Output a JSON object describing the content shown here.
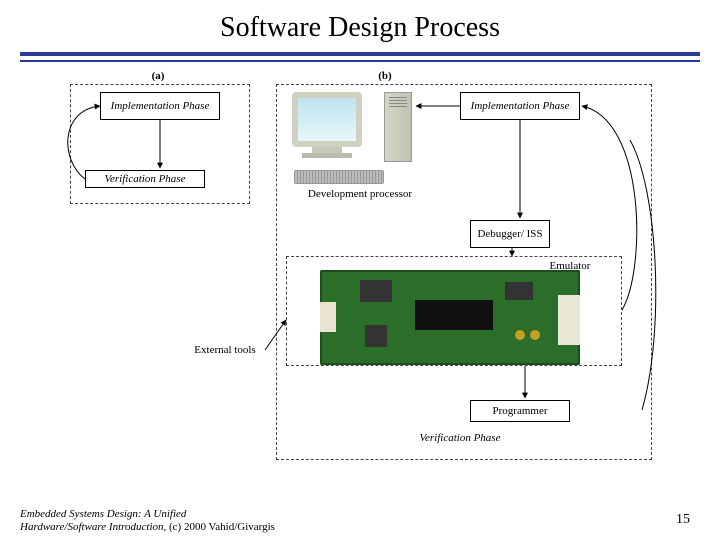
{
  "title": "Software Design Process",
  "labels": {
    "a": "(a)",
    "b": "(b)",
    "impl_a": "Implementation Phase",
    "impl_b": "Implementation Phase",
    "verif_a": "Verification Phase",
    "verif_b": "Verification Phase",
    "dev_proc": "Development processor",
    "debugger": "Debugger/ ISS",
    "emulator": "Emulator",
    "external": "External tools",
    "programmer": "Programmer"
  },
  "footer": {
    "line1": "Embedded Systems Design: A Unified",
    "line2": "Hardware/Software Introduction,",
    "copyright": " (c) 2000 Vahid/Givargis"
  },
  "page": "15"
}
